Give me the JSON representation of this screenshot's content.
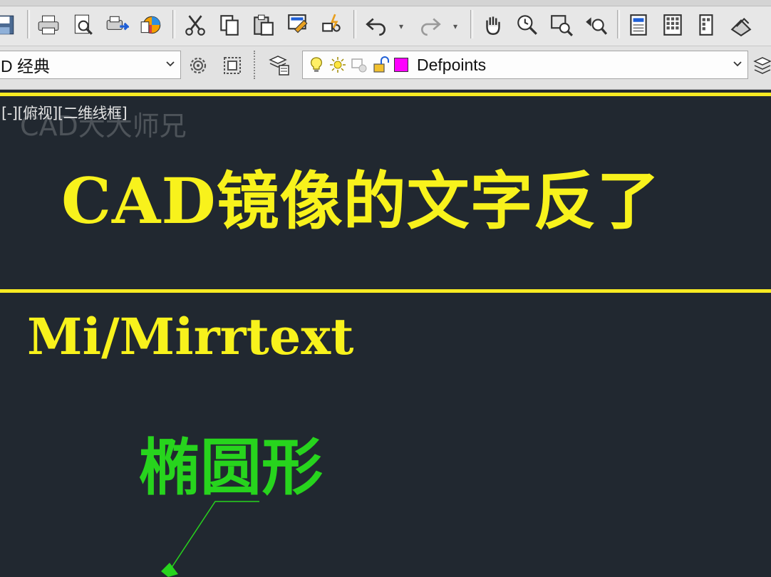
{
  "toolbar": {
    "icons": [
      "save-icon",
      "print-icon",
      "print-preview-icon",
      "publish-icon",
      "3d-dwf-icon",
      "cut-icon",
      "copy-icon",
      "paste-icon",
      "match-properties-icon",
      "block-editor-icon",
      "undo-icon",
      "redo-icon",
      "pan-icon",
      "zoom-realtime-icon",
      "zoom-window-icon",
      "zoom-previous-icon",
      "properties-icon",
      "design-center-icon",
      "tool-palettes-icon",
      "markup-icon"
    ]
  },
  "workspace": {
    "selected": "D 经典"
  },
  "layer": {
    "selected": "Defpoints",
    "swatch_color": "#ff00ff"
  },
  "viewport": {
    "label": "[-][俯视][二维线框]",
    "watermark": "CAD大大师兄"
  },
  "drawing": {
    "title": "CAD镜像的文字反了",
    "command": "Mi/Mirrtext",
    "ellipse_label": "椭圆形",
    "title_color": "#f8f21c",
    "ellipse_color": "#27d41d"
  }
}
